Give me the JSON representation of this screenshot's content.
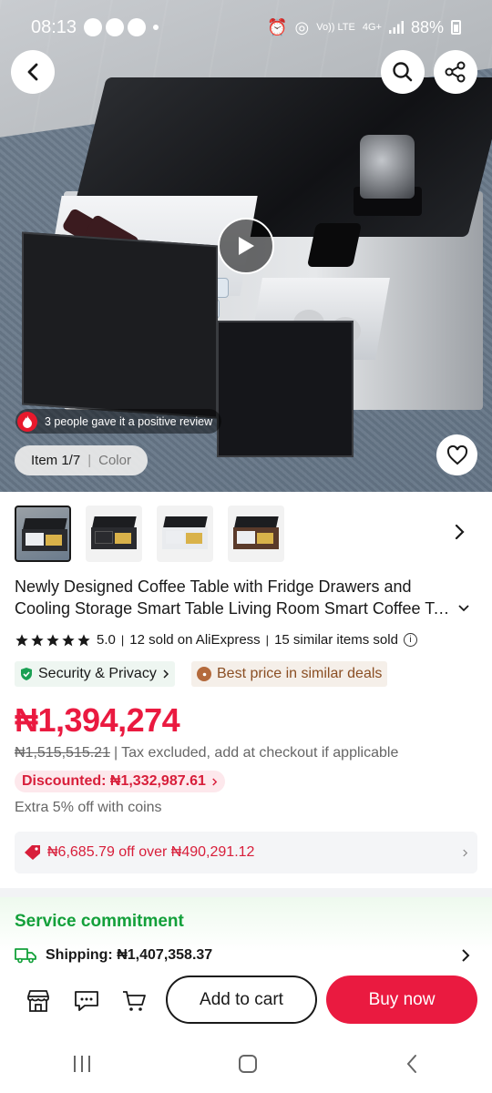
{
  "status_bar": {
    "time": "08:13",
    "volte": "Vo)) LTE",
    "network": "4G+",
    "battery": "88%"
  },
  "hero": {
    "review_chip": "3 people gave it a positive review",
    "item_label": "Item 1/7",
    "color_label": "Color"
  },
  "thumbnails": [
    "main",
    "variant-black",
    "variant-white",
    "variant-black-2"
  ],
  "product": {
    "title_line1": "Newly Designed Coffee Table with Fridge Drawers and",
    "title_line2": "Cooling Storage Smart Table Living Room Smart Coffee Ta..."
  },
  "meta": {
    "rating": "5.0",
    "sold": "12 sold on AliExpress",
    "similar": "15 similar items sold"
  },
  "badges": {
    "security": "Security & Privacy",
    "best_price": "Best price in similar deals"
  },
  "price": {
    "current": "₦1,394,274",
    "original": "₦1,515,515.21",
    "tax_note": "Tax excluded, add at checkout if applicable",
    "discounted": "Discounted: ₦1,332,987.61",
    "coins": "Extra 5% off with coins"
  },
  "coupon": {
    "text": "₦6,685.79 off over ₦490,291.12"
  },
  "service": {
    "title": "Service commitment",
    "shipping_label": "Shipping:",
    "shipping_value": "₦1,407,358.37"
  },
  "actions": {
    "add_to_cart": "Add to cart",
    "buy_now": "Buy now"
  },
  "colors": {
    "accent_red": "#ea1a40",
    "service_green": "#13a03a",
    "security_green": "#0a7d3e"
  }
}
